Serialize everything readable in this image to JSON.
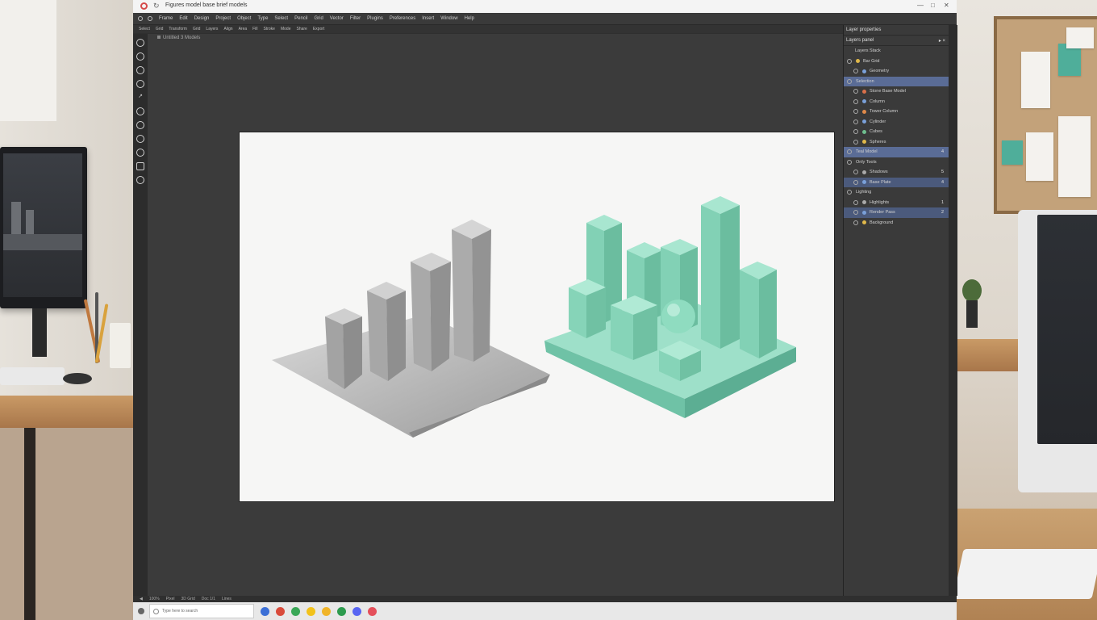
{
  "window": {
    "title": "Figures model base brief models",
    "controls": [
      "—",
      "□",
      "✕"
    ]
  },
  "menu": {
    "items": [
      "Frame",
      "Edit",
      "Design",
      "Project",
      "Object",
      "Type",
      "Select",
      "Pencil",
      "Grid",
      "Vector",
      "Filter",
      "Plugins",
      "Preferences",
      "Insert",
      "Window",
      "Help"
    ]
  },
  "options_bar": {
    "items": [
      "Select",
      "Grid",
      "Transform",
      "Grid",
      "Layers",
      "Align",
      "Area",
      "Fill",
      "Stroke",
      "Mode",
      "Share",
      "Export"
    ]
  },
  "document": {
    "tab_label": "Untitled 3 Models"
  },
  "tools": [
    "move-icon",
    "select-icon",
    "lasso-icon",
    "crop-icon",
    "pen-icon",
    "brush-icon",
    "eraser-icon",
    "fill-icon",
    "text-icon",
    "shape-icon",
    "zoom-icon"
  ],
  "status_bar": {
    "items": [
      "◀",
      "100%",
      "Pixel",
      "3D Grid",
      "Doc 1/1",
      "Lines"
    ]
  },
  "taskbar": {
    "search_placeholder": "Type here to search",
    "apps": [
      {
        "name": "browser-icon",
        "color": "#3b6fd6"
      },
      {
        "name": "mail-icon",
        "color": "#d94b3b"
      },
      {
        "name": "chrome-icon",
        "color": "#3aa757"
      },
      {
        "name": "notes-icon",
        "color": "#f2c21b"
      },
      {
        "name": "files-icon",
        "color": "#f0b429"
      },
      {
        "name": "store-icon",
        "color": "#2d9b4e"
      },
      {
        "name": "discord-icon",
        "color": "#5865f2"
      },
      {
        "name": "photos-icon",
        "color": "#e44f5a"
      }
    ]
  },
  "panel": {
    "title": "Layer properties",
    "tab": "Layers panel",
    "section": "Layers Stack",
    "layers": [
      {
        "label": "Bar Grid",
        "dot": "#e0b84a",
        "style": ""
      },
      {
        "label": "Geometry",
        "dot": "#7aa0d9",
        "style": ""
      },
      {
        "label": "Selection",
        "dot": "",
        "style": "sel"
      },
      {
        "label": "Stone Base Model",
        "dot": "#d9704a",
        "style": ""
      },
      {
        "label": "Column",
        "dot": "#7aa0d9",
        "style": ""
      },
      {
        "label": "Tower Column",
        "dot": "#e08a4a",
        "style": ""
      },
      {
        "label": "Cylinder",
        "dot": "#7aa0d9",
        "style": ""
      },
      {
        "label": "Cubes",
        "dot": "#6fbf8f",
        "style": ""
      },
      {
        "label": "Spheres",
        "dot": "#e0b84a",
        "style": ""
      },
      {
        "label": "Teal Model",
        "dot": "",
        "style": "sel",
        "num": "4"
      },
      {
        "label": "Only Tools",
        "dot": "",
        "style": ""
      },
      {
        "label": "Shadows",
        "dot": "#aaaaaa",
        "style": "",
        "num": "5"
      },
      {
        "label": "Base Plate",
        "dot": "#7aa0d9",
        "style": "sel2",
        "num": "4"
      },
      {
        "label": "Lighting",
        "dot": "",
        "style": ""
      },
      {
        "label": "Highlights",
        "dot": "#aaaaaa",
        "style": "",
        "num": "1"
      },
      {
        "label": "Render Pass",
        "dot": "#7aa0d9",
        "style": "sel2",
        "num": "2"
      },
      {
        "label": "Background",
        "dot": "#e0b84a",
        "style": ""
      }
    ]
  },
  "colors": {
    "teal": "#7fd4b6",
    "stone": "#a9a9a9",
    "panel_select": "#5a6c96"
  }
}
